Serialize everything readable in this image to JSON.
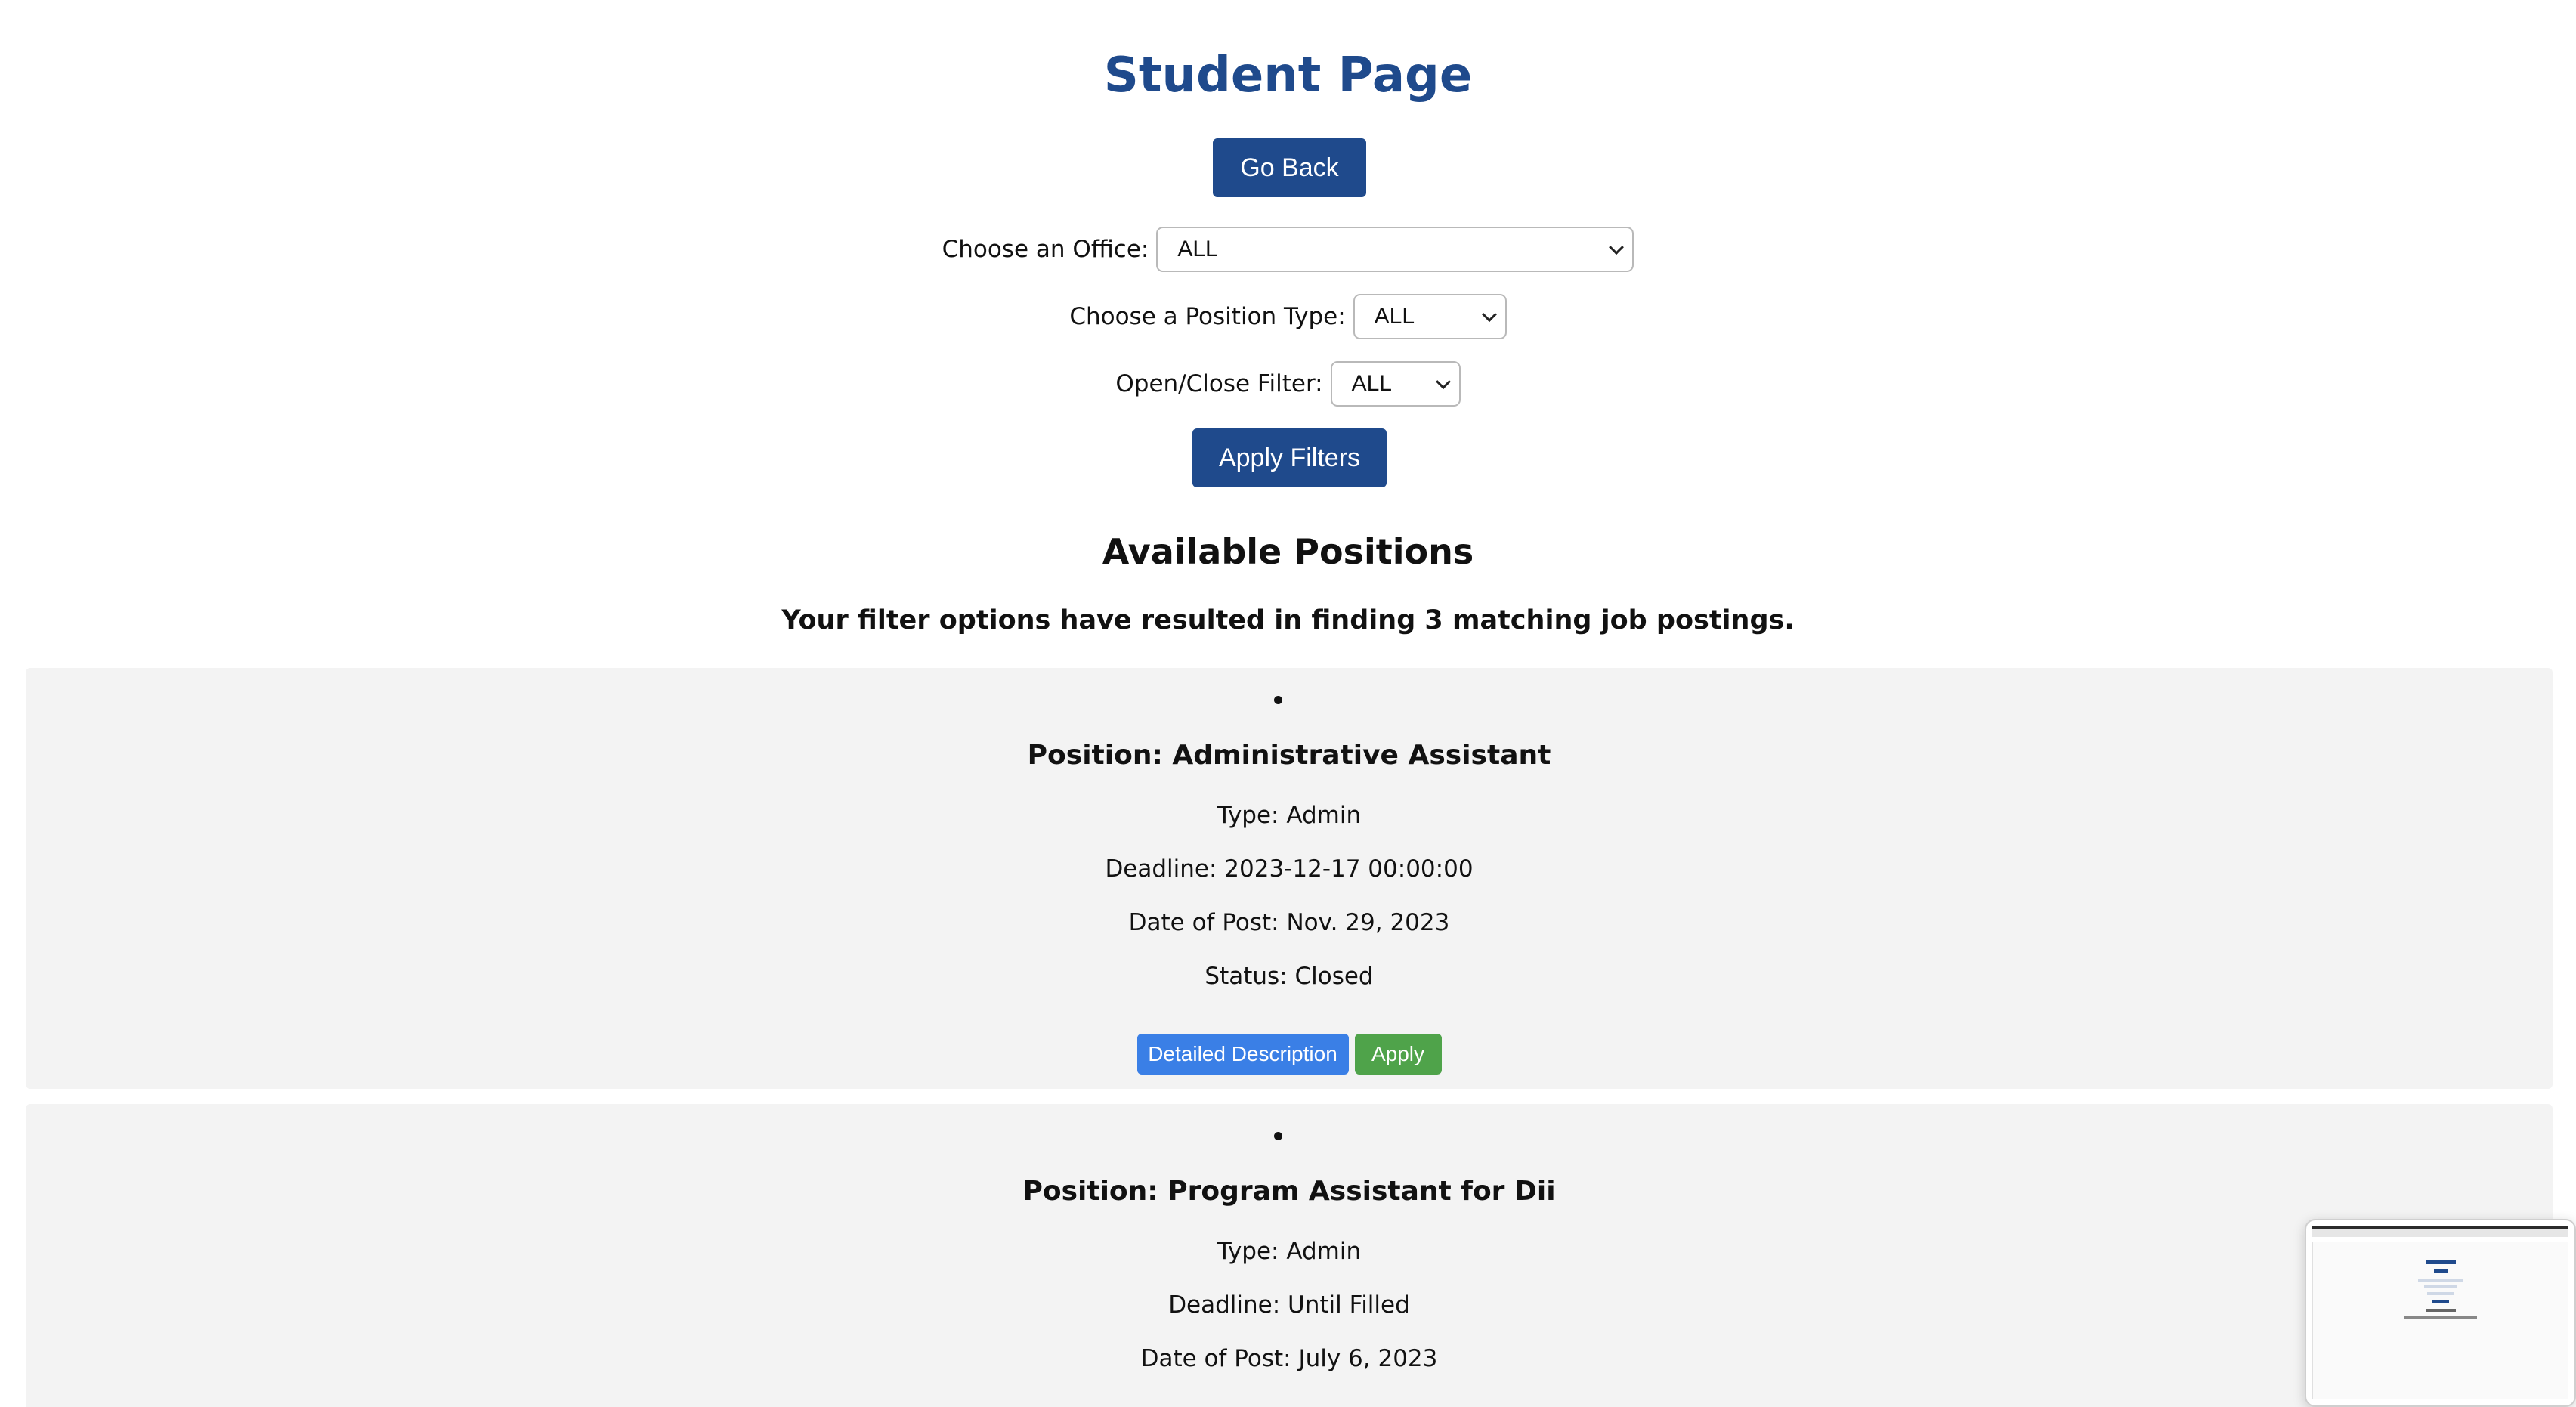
{
  "header": {
    "title": "Student Page",
    "go_back_label": "Go Back"
  },
  "filters": {
    "office_label": "Choose an Office:",
    "office_value": "ALL",
    "position_type_label": "Choose a Position Type:",
    "position_type_value": "ALL",
    "open_close_label": "Open/Close Filter:",
    "open_close_value": "ALL",
    "apply_label": "Apply Filters"
  },
  "results": {
    "heading": "Available Positions",
    "summary": "Your filter options have resulted in finding 3 matching job postings."
  },
  "postings": [
    {
      "position": "Position: Administrative Assistant",
      "type": "Type: Admin",
      "deadline": "Deadline: 2023-12-17 00:00:00",
      "date_of_post": "Date of Post: Nov. 29, 2023",
      "status": "Status: Closed",
      "description_label": "Detailed Description",
      "apply_label": "Apply"
    },
    {
      "position": "Position: Program Assistant for Dii",
      "type": "Type: Admin",
      "deadline": "Deadline: Until Filled",
      "date_of_post": "Date of Post: July 6, 2023"
    }
  ]
}
